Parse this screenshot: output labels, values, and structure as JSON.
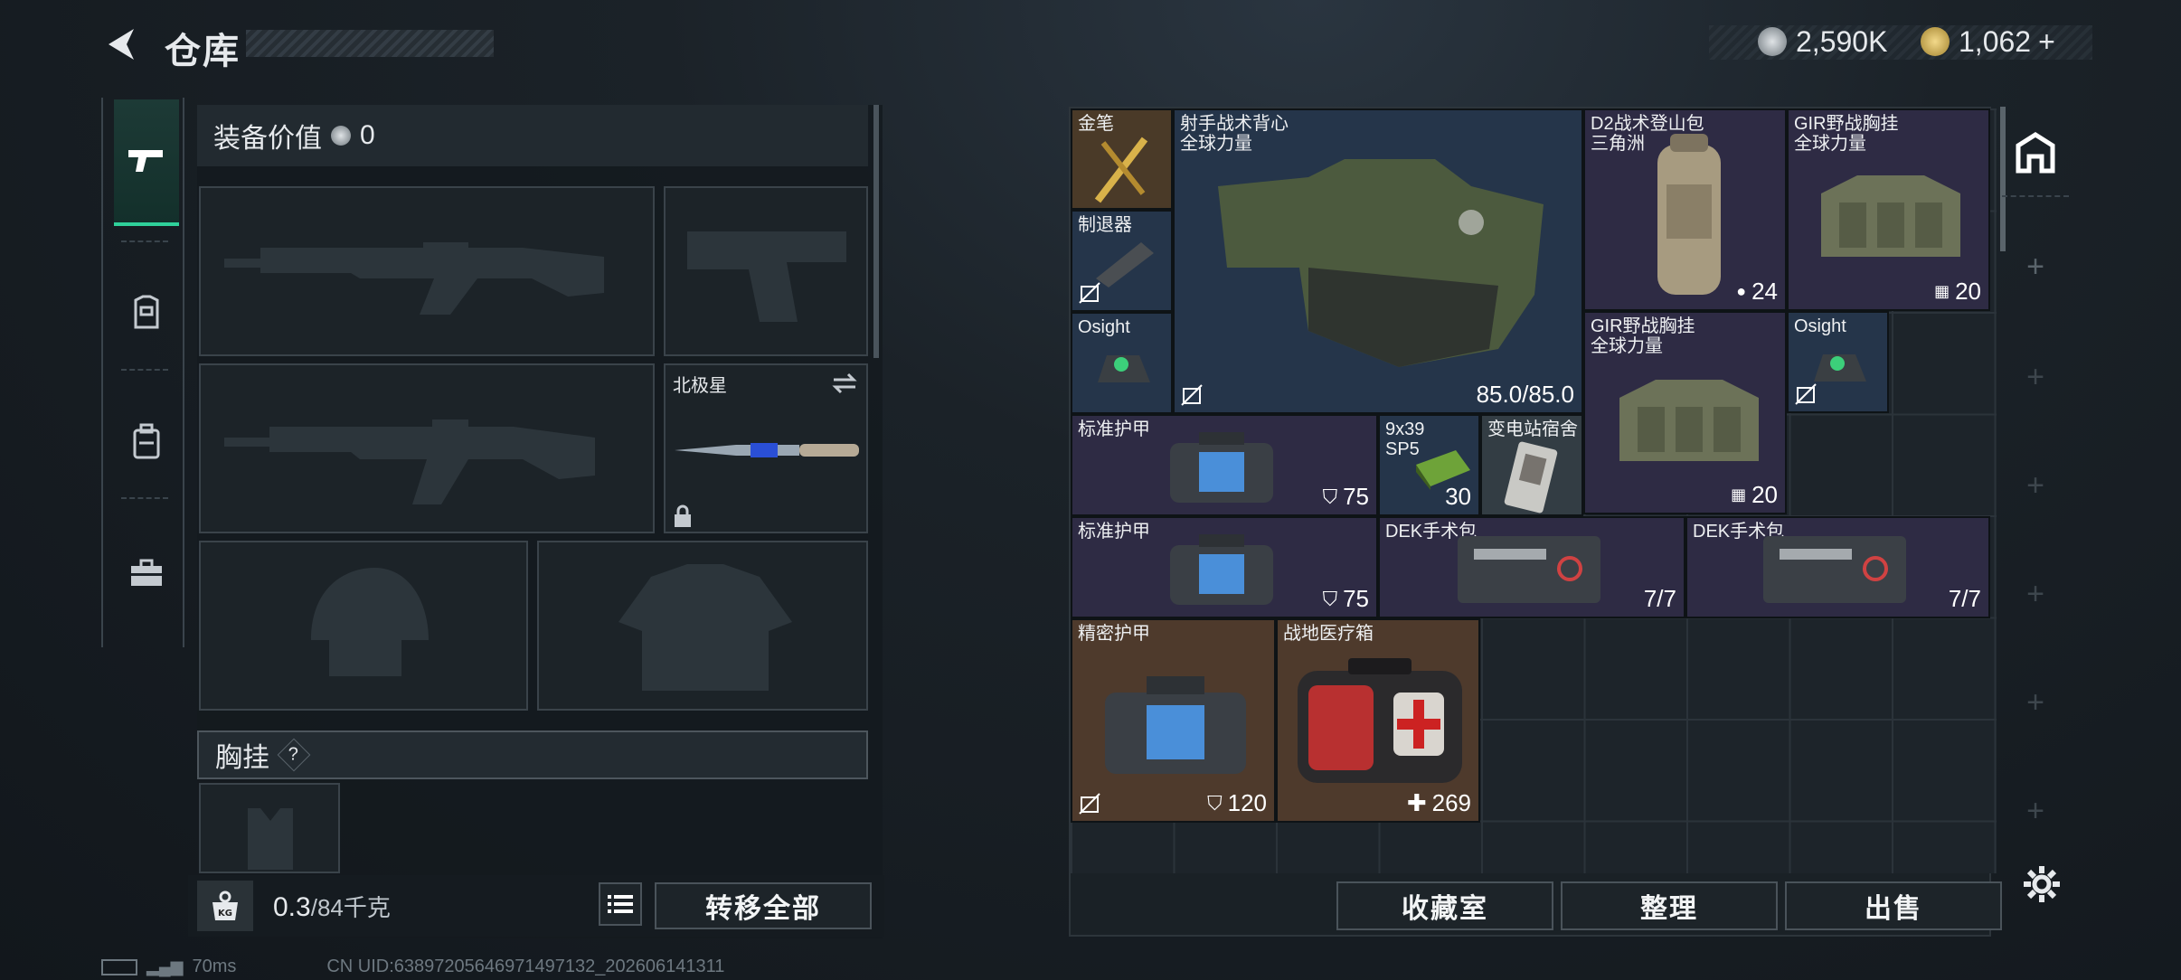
{
  "header": {
    "title": "仓库",
    "currency_silver": "2,590K",
    "currency_gold": "1,062",
    "gold_plus": "+"
  },
  "equipment": {
    "value_label": "装备价值",
    "value": "0",
    "melee_name": "北极星",
    "chest_label": "胸挂",
    "chest_help": "?"
  },
  "bottom": {
    "weight_current": "0.3",
    "weight_max": "/84千克",
    "transfer_all": "转移全部",
    "kg_badge": "KG"
  },
  "storage": {
    "items": [
      {
        "id": "gold-pen",
        "name": "金笔",
        "value": ""
      },
      {
        "id": "vest",
        "name": "射手战术背心\n全球力量",
        "value": "85.0/85.0"
      },
      {
        "id": "backpack",
        "name": "D2战术登山包\n三角洲",
        "value": "24"
      },
      {
        "id": "rig1",
        "name": "GIR野战胸挂\n全球力量",
        "value": "20"
      },
      {
        "id": "recoil",
        "name": "制退器",
        "value": ""
      },
      {
        "id": "osight1",
        "name": "Osight",
        "value": ""
      },
      {
        "id": "rig2",
        "name": "GIR野战胸挂\n全球力量",
        "value": "20"
      },
      {
        "id": "osight2",
        "name": "Osight",
        "value": ""
      },
      {
        "id": "armor1",
        "name": "标准护甲",
        "value": "75"
      },
      {
        "id": "ammo",
        "name": "9x39\nSP5",
        "value": "30"
      },
      {
        "id": "dorm",
        "name": "变电站宿舍",
        "value": ""
      },
      {
        "id": "armor2",
        "name": "标准护甲",
        "value": "75"
      },
      {
        "id": "dek1",
        "name": "DEK手术包",
        "value": "7/7"
      },
      {
        "id": "dek2",
        "name": "DEK手术包",
        "value": "7/7"
      },
      {
        "id": "armor3",
        "name": "精密护甲",
        "value": "120"
      },
      {
        "id": "medkit",
        "name": "战地医疗箱",
        "value": "269"
      }
    ],
    "buttons": {
      "collection": "收藏室",
      "organize": "整理",
      "sell": "出售"
    }
  },
  "footer": {
    "ping": "70ms",
    "uid": "CN UID:6389720564697149713​2_202606141311"
  },
  "colors": {
    "accent": "#2fd19a",
    "rare_blue": "#25354a",
    "epic_purple": "#2e2b44",
    "legend_gold": "#4a3a28"
  }
}
